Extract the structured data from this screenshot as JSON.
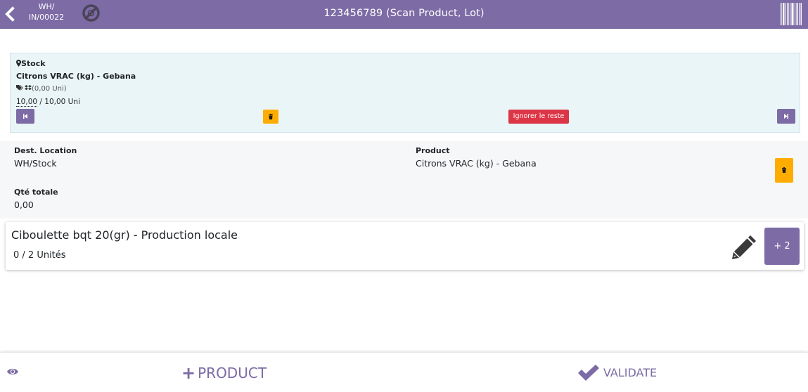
{
  "header": {
    "reference_line1": "WH/",
    "reference_line2": "IN/00022",
    "title": "123456789 (Scan Product, Lot)",
    "icons": [
      "chevron-left-icon",
      "no-package-icon",
      "barcode-icon"
    ]
  },
  "move_line": {
    "location": "Stock",
    "product": "Citrons VRAC (kg) - Gebana",
    "package": "(0,00 Uni)",
    "qty_done": "10,00",
    "qty_total": " / 10,00 Uni",
    "ignore_label": "Ignorer le reste"
  },
  "detail": {
    "dest_label": "Dest. Location",
    "dest_value": "WH/Stock",
    "product_label": "Product",
    "product_value": "Citrons VRAC (kg) - Gebana",
    "total_label": "Qté totale",
    "total_value": "0,00"
  },
  "product_card": {
    "name": "Ciboulette bqt 20(gr) - Production locale",
    "quantity": "0 / 2 Unités",
    "increment_label": "+ 2"
  },
  "footer": {
    "add_product_label": "PRODUCT",
    "validate_label": "VALIDATE"
  },
  "colors": {
    "primary": "#7c6ba5",
    "warning": "#ffac00",
    "danger": "#dc3545",
    "line_bg": "#eaf5f7"
  }
}
